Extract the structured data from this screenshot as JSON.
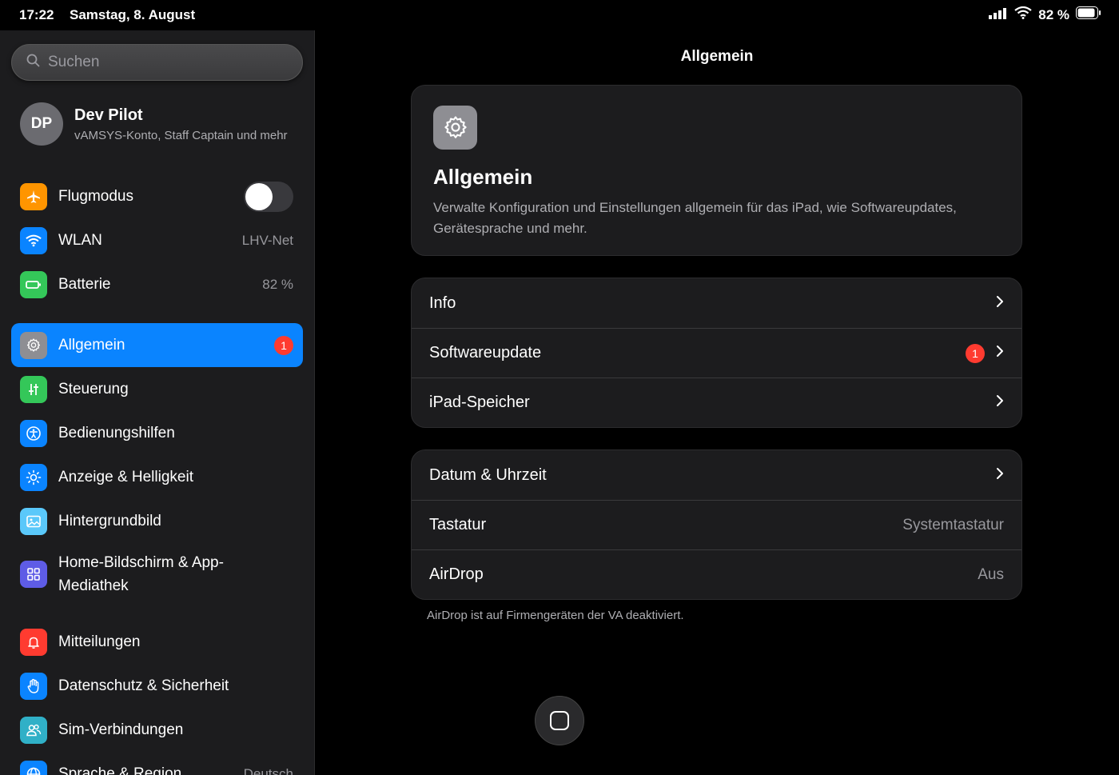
{
  "status_bar": {
    "time": "17:22",
    "date": "Samstag, 8. August",
    "battery": "82 %"
  },
  "sidebar": {
    "search_placeholder": "Suchen",
    "profile": {
      "initials": "DP",
      "name": "Dev Pilot",
      "subtitle": "vAMSYS-Konto, Staff Captain und mehr"
    },
    "items": [
      {
        "label": "Flugmodus",
        "icon": "airplane-icon",
        "color": "#ff9500",
        "toggle": false
      },
      {
        "label": "WLAN",
        "icon": "wifi-icon",
        "color": "#0a84ff",
        "value": "LHV-Net"
      },
      {
        "label": "Batterie",
        "icon": "battery-icon",
        "color": "#34c759",
        "value": "82 %"
      },
      {
        "label": "Allgemein",
        "icon": "gear-icon",
        "color": "#8e8e93",
        "badge": "1",
        "active": true
      },
      {
        "label": "Steuerung",
        "icon": "sliders-icon",
        "color": "#34c759"
      },
      {
        "label": "Bedienungshilfen",
        "icon": "accessibility-icon",
        "color": "#0a84ff"
      },
      {
        "label": "Anzeige & Helligkeit",
        "icon": "sun-icon",
        "color": "#0a84ff"
      },
      {
        "label": "Hintergrundbild",
        "icon": "image-icon",
        "color": "#5ac8fa"
      },
      {
        "label": "Home-Bildschirm & App-Mediathek",
        "icon": "grid-icon",
        "color": "#5e5ce6"
      },
      {
        "label": "Mitteilungen",
        "icon": "bell-icon",
        "color": "#ff3b30"
      },
      {
        "label": "Datenschutz & Sicherheit",
        "icon": "hand-icon",
        "color": "#0a84ff"
      },
      {
        "label": "Sim-Verbindungen",
        "icon": "people-icon",
        "color": "#30b0c7"
      },
      {
        "label": "Sprache & Region",
        "icon": "globe-icon",
        "color": "#0a84ff",
        "value": "Deutsch"
      }
    ]
  },
  "main": {
    "title": "Allgemein",
    "hero": {
      "title": "Allgemein",
      "description": "Verwalte Konfiguration und Einstellungen allgemein für das iPad, wie Softwareupdates, Gerätesprache und mehr."
    },
    "group1": [
      {
        "label": "Info"
      },
      {
        "label": "Softwareupdate",
        "badge": "1"
      },
      {
        "label": "iPad-Speicher"
      }
    ],
    "group2": [
      {
        "label": "Datum & Uhrzeit"
      },
      {
        "label": "Tastatur",
        "value": "Systemtastatur"
      },
      {
        "label": "AirDrop",
        "value": "Aus"
      }
    ],
    "footnote": "AirDrop ist auf Firmengeräten der VA deaktiviert."
  }
}
